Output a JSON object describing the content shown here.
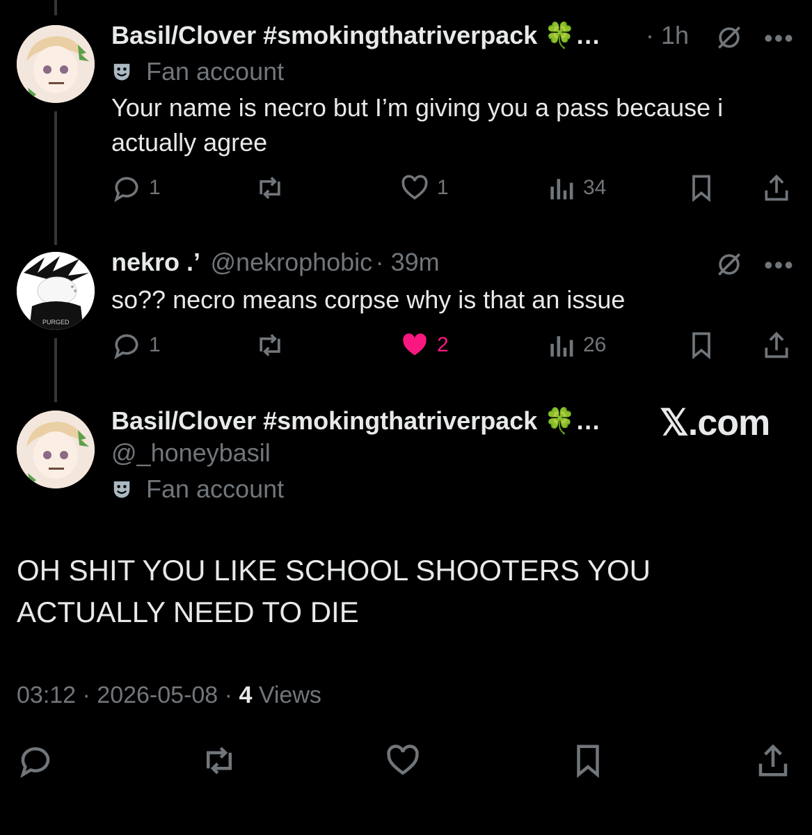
{
  "tweet1": {
    "display_name": "Basil/Clover #smokingthatriverpack 🍀…",
    "time": "· 1h",
    "badge": "Fan account",
    "text": "Your name is necro but I’m giving you a pass because i actually agree",
    "replies": "1",
    "likes": "1",
    "views": "34"
  },
  "tweet2": {
    "display_name": "nekro .’",
    "handle": "@nekrophobic",
    "time": "· 39m",
    "text": "so?? necro means corpse why is that an issue",
    "replies": "1",
    "likes": "2",
    "views": "26",
    "avatar_text": "PURGED"
  },
  "main_tweet": {
    "display_name": "Basil/Clover #smokingthatriverpack 🍀…",
    "handle": "@_honeybasil",
    "badge": "Fan account",
    "text": "OH SHIT YOU LIKE SCHOOL SHOOTERS YOU ACTUALLY NEED TO DIE",
    "timestamp": "03:12 · 2026-05-08 ·",
    "views_count": "4",
    "views_label": "Views"
  },
  "watermark": "𝕏.com",
  "colors": {
    "like_active": "#f91880",
    "muted": "#71767b",
    "text": "#e7e9ea"
  },
  "icons": [
    "reply-icon",
    "retweet-icon",
    "like-icon",
    "views-icon",
    "bookmark-icon",
    "share-icon",
    "grok-icon",
    "more-icon",
    "mask-icon"
  ]
}
